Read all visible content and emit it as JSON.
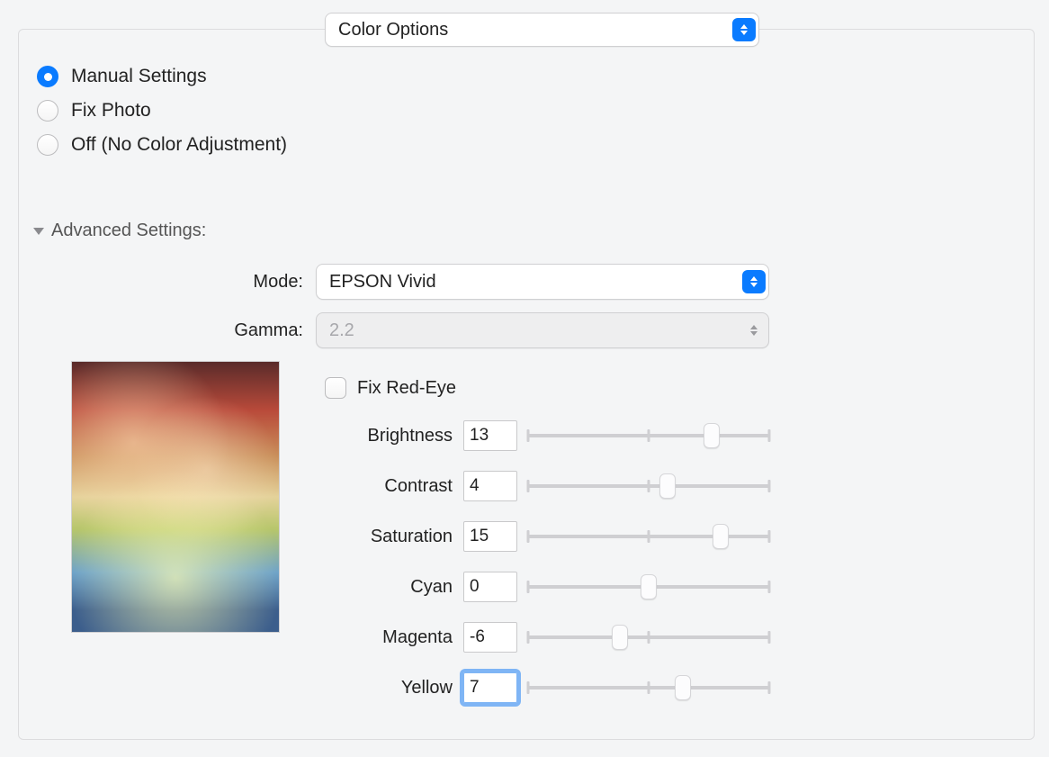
{
  "header": {
    "select_value": "Color Options"
  },
  "radio": {
    "manual": "Manual Settings",
    "fix_photo": "Fix Photo",
    "off": "Off (No Color Adjustment)",
    "selected": "manual"
  },
  "advanced": {
    "label": "Advanced Settings:",
    "mode_label": "Mode:",
    "mode_value": "EPSON Vivid",
    "gamma_label": "Gamma:",
    "gamma_value": "2.2",
    "fix_red_eye_label": "Fix Red-Eye",
    "fix_red_eye_checked": false
  },
  "sliders": {
    "range_min": -25,
    "range_max": 25,
    "brightness": {
      "label": "Brightness",
      "value": 13
    },
    "contrast": {
      "label": "Contrast",
      "value": 4
    },
    "saturation": {
      "label": "Saturation",
      "value": 15
    },
    "cyan": {
      "label": "Cyan",
      "value": 0
    },
    "magenta": {
      "label": "Magenta",
      "value": -6
    },
    "yellow": {
      "label": "Yellow",
      "value": 7
    }
  }
}
